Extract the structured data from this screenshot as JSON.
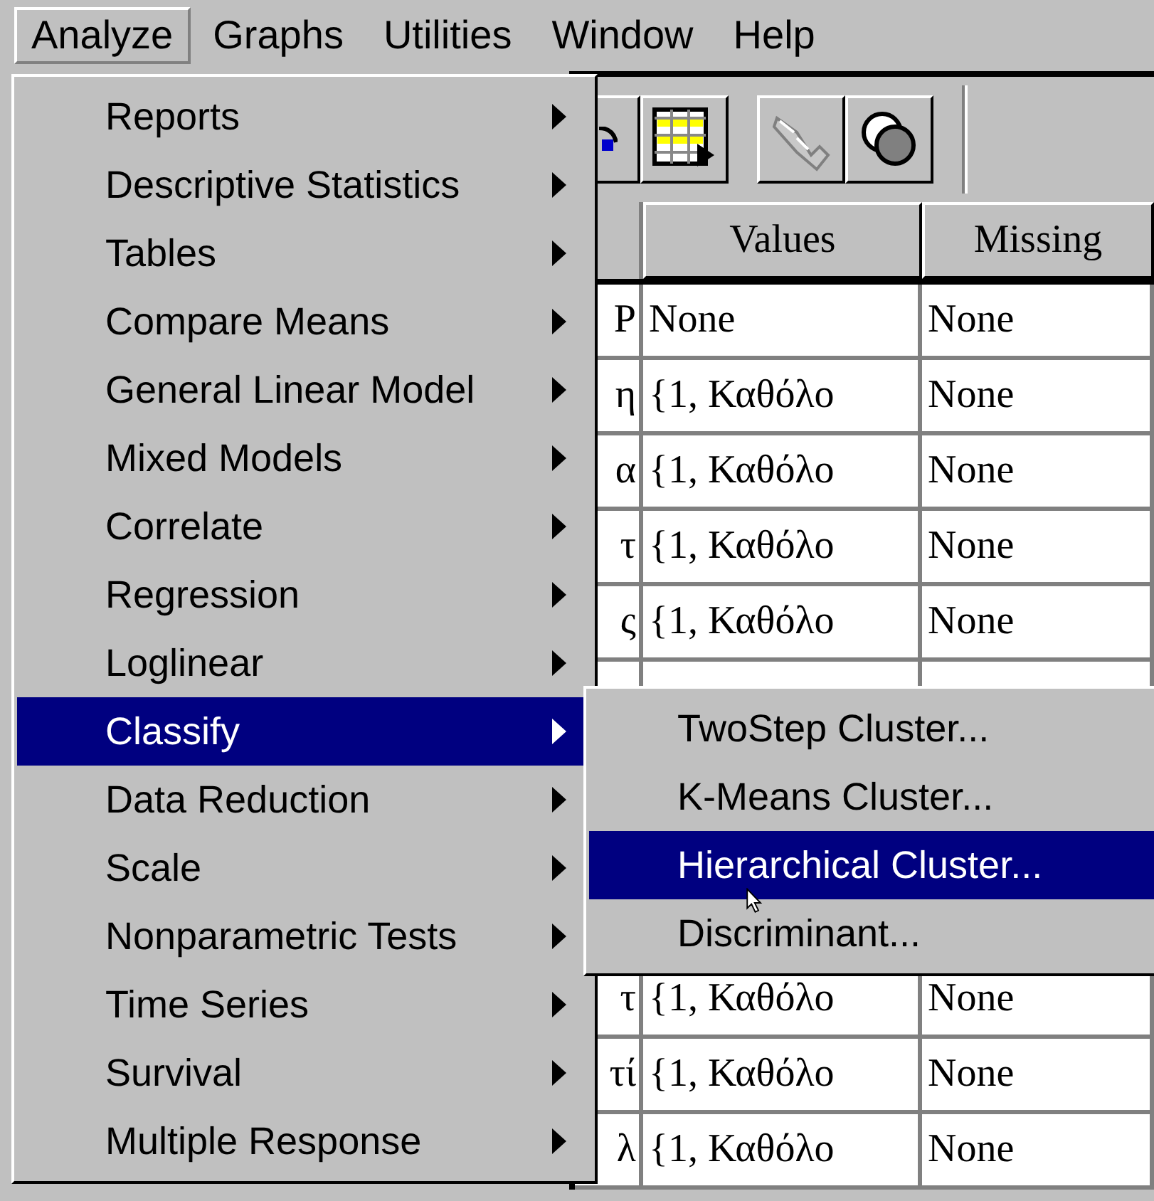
{
  "menu_bar": [
    {
      "label": "Analyze",
      "selected": true
    },
    {
      "label": "Graphs",
      "selected": false
    },
    {
      "label": "Utilities",
      "selected": false
    },
    {
      "label": "Window",
      "selected": false
    },
    {
      "label": "Help",
      "selected": false
    }
  ],
  "menu": {
    "items": [
      {
        "label": "Reports",
        "selected": false,
        "has_submenu": true
      },
      {
        "label": "Descriptive Statistics",
        "selected": false,
        "has_submenu": true
      },
      {
        "label": "Tables",
        "selected": false,
        "has_submenu": true
      },
      {
        "label": "Compare Means",
        "selected": false,
        "has_submenu": true
      },
      {
        "label": "General Linear Model",
        "selected": false,
        "has_submenu": true
      },
      {
        "label": "Mixed Models",
        "selected": false,
        "has_submenu": true
      },
      {
        "label": "Correlate",
        "selected": false,
        "has_submenu": true
      },
      {
        "label": "Regression",
        "selected": false,
        "has_submenu": true
      },
      {
        "label": "Loglinear",
        "selected": false,
        "has_submenu": true
      },
      {
        "label": "Classify",
        "selected": true,
        "has_submenu": true
      },
      {
        "label": "Data Reduction",
        "selected": false,
        "has_submenu": true
      },
      {
        "label": "Scale",
        "selected": false,
        "has_submenu": true
      },
      {
        "label": "Nonparametric Tests",
        "selected": false,
        "has_submenu": true
      },
      {
        "label": "Time Series",
        "selected": false,
        "has_submenu": true
      },
      {
        "label": "Survival",
        "selected": false,
        "has_submenu": true
      },
      {
        "label": "Multiple Response",
        "selected": false,
        "has_submenu": true
      }
    ]
  },
  "submenu": {
    "items": [
      {
        "label": "TwoStep Cluster...",
        "selected": false
      },
      {
        "label": "K-Means Cluster...",
        "selected": false
      },
      {
        "label": "Hierarchical Cluster...",
        "selected": true
      },
      {
        "label": "Discriminant...",
        "selected": false
      }
    ]
  },
  "table": {
    "columns": [
      {
        "label": "Values"
      },
      {
        "label": "Missing"
      }
    ],
    "rows_top": [
      {
        "column_1": "P",
        "values": "None",
        "missing": "None"
      },
      {
        "column_1": "η",
        "values": "{1, Καθόλο",
        "missing": "None"
      },
      {
        "column_1": "α",
        "values": "{1, Καθόλο",
        "missing": "None"
      },
      {
        "column_1": "τ",
        "values": "{1, Καθόλο",
        "missing": "None"
      },
      {
        "column_1": "ς",
        "values": "{1, Καθόλο",
        "missing": "None"
      }
    ],
    "rows_bottom": [
      {
        "column_1": "τ",
        "values": "{1, Καθόλο",
        "missing": "None"
      },
      {
        "column_1": "τί",
        "values": "{1, Καθόλο",
        "missing": "None"
      },
      {
        "column_1": "λ",
        "values": "{1, Καθόλο",
        "missing": "None"
      }
    ]
  }
}
